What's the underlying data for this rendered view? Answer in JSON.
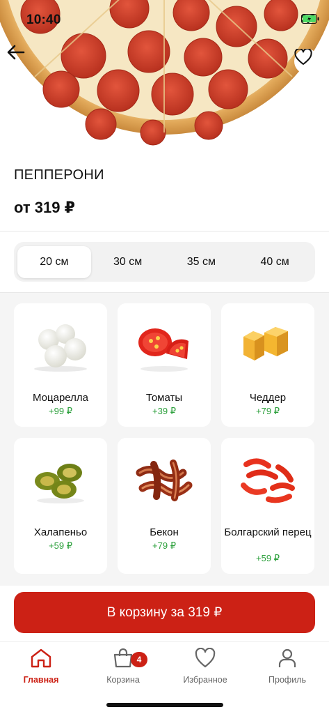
{
  "status": {
    "time": "10:40"
  },
  "product": {
    "title": "ПЕППЕРОНИ",
    "price": "от 319 ₽"
  },
  "sizes": [
    {
      "label": "20 см",
      "selected": true
    },
    {
      "label": "30 см",
      "selected": false
    },
    {
      "label": "35 см",
      "selected": false
    },
    {
      "label": "40 см",
      "selected": false
    }
  ],
  "toppings": [
    {
      "name": "Моцарелла",
      "price": "+99 ₽",
      "icon": "mozzarella-icon"
    },
    {
      "name": "Томаты",
      "price": "+39 ₽",
      "icon": "tomato-icon"
    },
    {
      "name": "Чеддер",
      "price": "+79 ₽",
      "icon": "cheddar-icon"
    },
    {
      "name": "Халапеньо",
      "price": "+59 ₽",
      "icon": "jalapeno-icon"
    },
    {
      "name": "Бекон",
      "price": "+79 ₽",
      "icon": "bacon-icon"
    },
    {
      "name": "Болгарский перец",
      "price": "+59 ₽",
      "icon": "bell-pepper-icon"
    }
  ],
  "cta": {
    "label": "В корзину за 319 ₽"
  },
  "tabbar": {
    "items": [
      {
        "label": "Главная",
        "icon": "home-icon",
        "active": true
      },
      {
        "label": "Корзина",
        "icon": "cart-icon",
        "active": false
      },
      {
        "label": "Избранное",
        "icon": "heart-icon",
        "active": false
      },
      {
        "label": "Профиль",
        "icon": "profile-icon",
        "active": false
      }
    ],
    "cart_badge": "4"
  },
  "colors": {
    "accent": "#cc2115",
    "price_green": "#2ca03c",
    "surface": "#f5f5f5"
  }
}
